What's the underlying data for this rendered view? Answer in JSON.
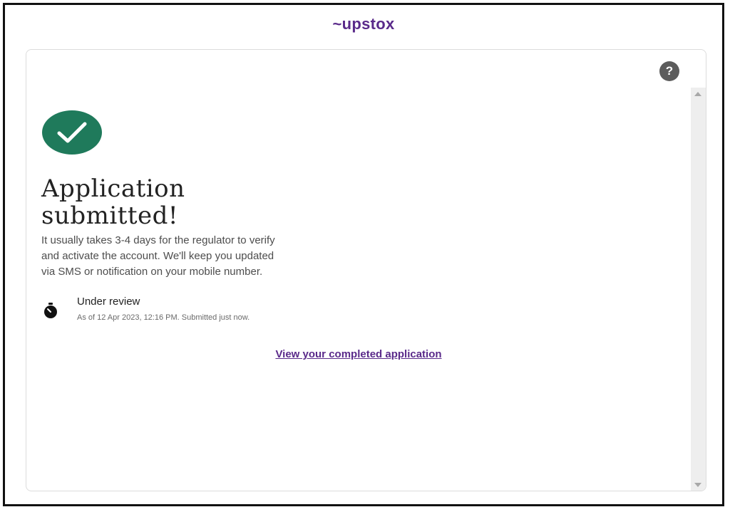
{
  "brand": {
    "mark": "~",
    "name": "upstox"
  },
  "help": {
    "label": "?"
  },
  "status_main": {
    "title_line1": "Application",
    "title_line2": "submitted!",
    "description_line1": "It usually takes 3-4 days for the regulator to verify",
    "description_line2": "and activate the account. We'll keep you updated",
    "description_line3": "via SMS or notification on your mobile number."
  },
  "review": {
    "title": "Under review",
    "subtitle": "As of 12 Apr 2023, 12:16 PM. Submitted just now."
  },
  "actions": {
    "view_application": "View your completed application"
  },
  "colors": {
    "brand": "#5a2a8a",
    "success": "#1f7a5b",
    "help_bg": "#5c5c5c"
  },
  "icons": {
    "success": "check-circle-icon",
    "status": "timer-icon",
    "help": "question-icon"
  }
}
